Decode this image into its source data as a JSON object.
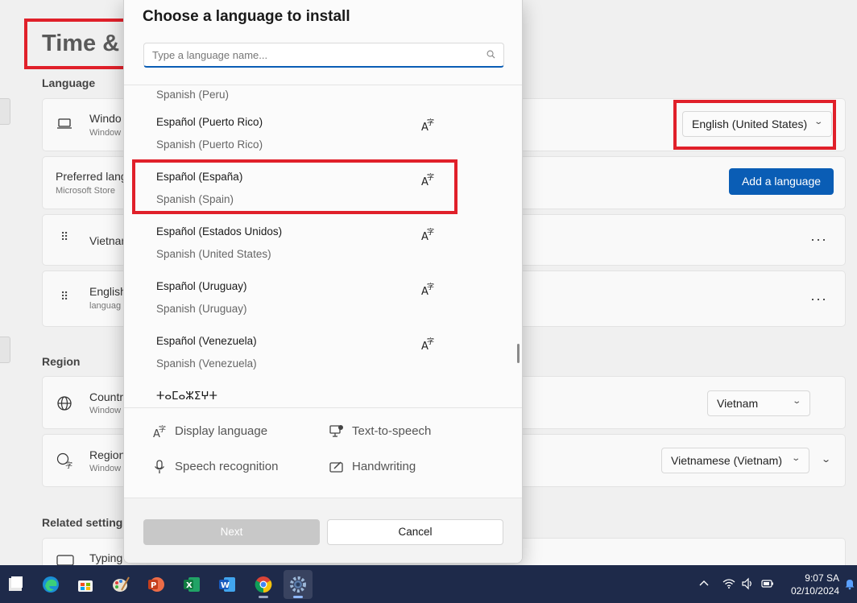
{
  "background": {
    "page_title": "Time & l",
    "language_section": "Language",
    "windows_display_card": {
      "title": "Windo",
      "subtitle": "Window",
      "value": "English (United States)"
    },
    "preferred_card": {
      "title": "Preferred lang",
      "subtitle": "Microsoft Store",
      "button": "Add a language"
    },
    "languages": [
      {
        "title": "Vietnar",
        "subtitle": ""
      },
      {
        "title": "English",
        "subtitle": "languag"
      }
    ],
    "more_label": "···",
    "region_section": "Region",
    "country_card": {
      "title": "Countr",
      "subtitle": "Window",
      "value": "Vietnam"
    },
    "regional_card": {
      "title": "Region",
      "subtitle": "Window",
      "value": "Vietnamese (Vietnam)"
    },
    "related_section": "Related settings",
    "typing_card": {
      "title": "Typing"
    }
  },
  "dialog": {
    "title": "Choose a language to install",
    "search": {
      "placeholder": "Type a language name...",
      "value": ""
    },
    "items": [
      {
        "name": "",
        "sub": "Spanish (Peru)",
        "feature": false
      },
      {
        "name": "Español (Puerto Rico)",
        "sub": "Spanish (Puerto Rico)",
        "feature": true
      },
      {
        "name": "Español (España)",
        "sub": "Spanish (Spain)",
        "feature": true
      },
      {
        "name": "Español (Estados Unidos)",
        "sub": "Spanish (United States)",
        "feature": true
      },
      {
        "name": "Español (Uruguay)",
        "sub": "Spanish (Uruguay)",
        "feature": true
      },
      {
        "name": "Español (Venezuela)",
        "sub": "Spanish (Venezuela)",
        "feature": true
      },
      {
        "name": "ⵜⴰⵎⴰⵣⵉⵖⵜ",
        "sub": "",
        "feature": false
      }
    ],
    "legend": {
      "display_language": "Display language",
      "text_to_speech": "Text-to-speech",
      "speech_recognition": "Speech recognition",
      "handwriting": "Handwriting"
    },
    "buttons": {
      "next": "Next",
      "cancel": "Cancel"
    }
  },
  "taskbar": {
    "apps": [
      "start-icon",
      "edge-icon",
      "store-icon",
      "paint-icon",
      "powerpoint-icon",
      "excel-icon",
      "word-icon",
      "chrome-icon",
      "settings-icon"
    ],
    "time": "9:07 SA",
    "date": "02/10/2024"
  },
  "colors": {
    "accent": "#0a5db5",
    "highlight": "#e0202a",
    "taskbar": "#1e2a4a"
  }
}
